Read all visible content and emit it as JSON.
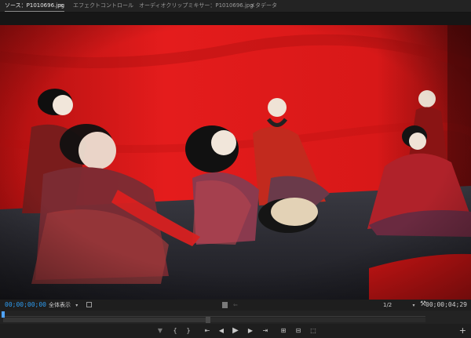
{
  "tabs": [
    {
      "label": "ソース：P1010696.jpg",
      "active": true
    },
    {
      "label": "エフェクトコントロール",
      "active": false
    },
    {
      "label": "オーディオクリップミキサー：P1010696.jpg",
      "active": false
    },
    {
      "label": "メタデータ",
      "active": false
    }
  ],
  "tab_menu_icon": "≡",
  "viewer": {
    "timecode_current": "00;00;00;00",
    "zoom_label": "全体表示",
    "zoom_caret": "▾",
    "resolution": "1/2",
    "resolution_caret": "▾",
    "wrench_icon": "🔧",
    "timecode_duration": "00;00;04;29",
    "playhead_position": 0
  },
  "transport": {
    "buttons": [
      {
        "name": "add-marker-button",
        "glyph": "▼"
      },
      {
        "name": "mark-in-button",
        "glyph": "{"
      },
      {
        "name": "mark-out-button",
        "glyph": "}"
      },
      {
        "name": "go-to-in-button",
        "glyph": "⇤"
      },
      {
        "name": "step-back-button",
        "glyph": "◀"
      },
      {
        "name": "play-button",
        "glyph": "▶"
      },
      {
        "name": "step-forward-button",
        "glyph": "▶"
      },
      {
        "name": "go-to-out-button",
        "glyph": "⇥"
      },
      {
        "name": "insert-button",
        "glyph": "⊞"
      },
      {
        "name": "overwrite-button",
        "glyph": "⊟"
      },
      {
        "name": "export-frame-button",
        "glyph": "⬚"
      }
    ],
    "add_button": "+"
  },
  "colors": {
    "accent_timecode": "#2e9cf0",
    "backdrop_red": "#d01818",
    "panel_bg": "#1e1e1e"
  }
}
